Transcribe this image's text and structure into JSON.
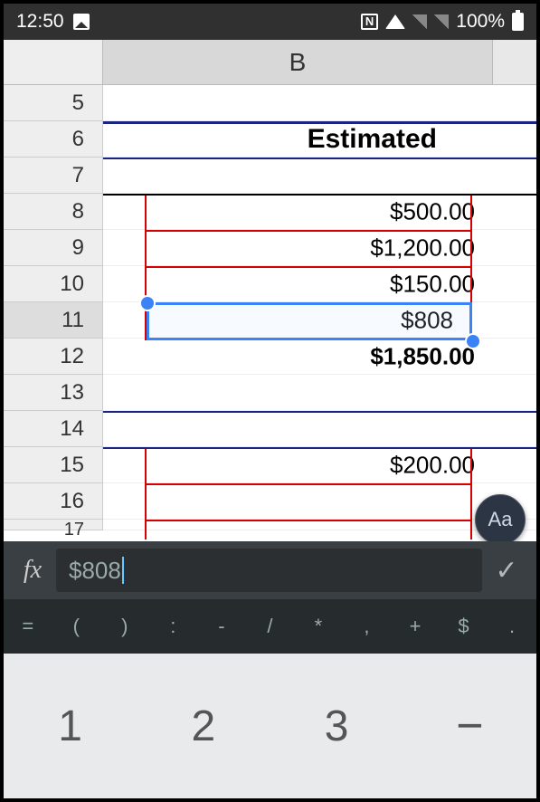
{
  "status": {
    "time": "12:50",
    "nfc": "N",
    "battery": "100%"
  },
  "columns": {
    "b": "B"
  },
  "rows": {
    "r5": "5",
    "r6": "6",
    "r7": "7",
    "r8": "8",
    "r9": "9",
    "r10": "10",
    "r11": "11",
    "r12": "12",
    "r13": "13",
    "r14": "14",
    "r15": "15",
    "r16": "16",
    "r17": "17"
  },
  "cells": {
    "b6": "Estimated",
    "b8": "$500.00",
    "b9": "$1,200.00",
    "b10": "$150.00",
    "b11": "$808",
    "b12": "$1,850.00",
    "b15": "$200.00"
  },
  "formula": {
    "label": "fx",
    "value": "$808",
    "confirm": "✓"
  },
  "symbols": {
    "eq": "=",
    "lp": "(",
    "rp": ")",
    "colon": ":",
    "dash": "-",
    "slash": "/",
    "star": "*",
    "comma": ",",
    "plus": "+",
    "dollar": "$",
    "dot": "."
  },
  "keypad": {
    "k1": "1",
    "k2": "2",
    "k3": "3",
    "minus": "−"
  },
  "fab": {
    "label": "Aa"
  }
}
